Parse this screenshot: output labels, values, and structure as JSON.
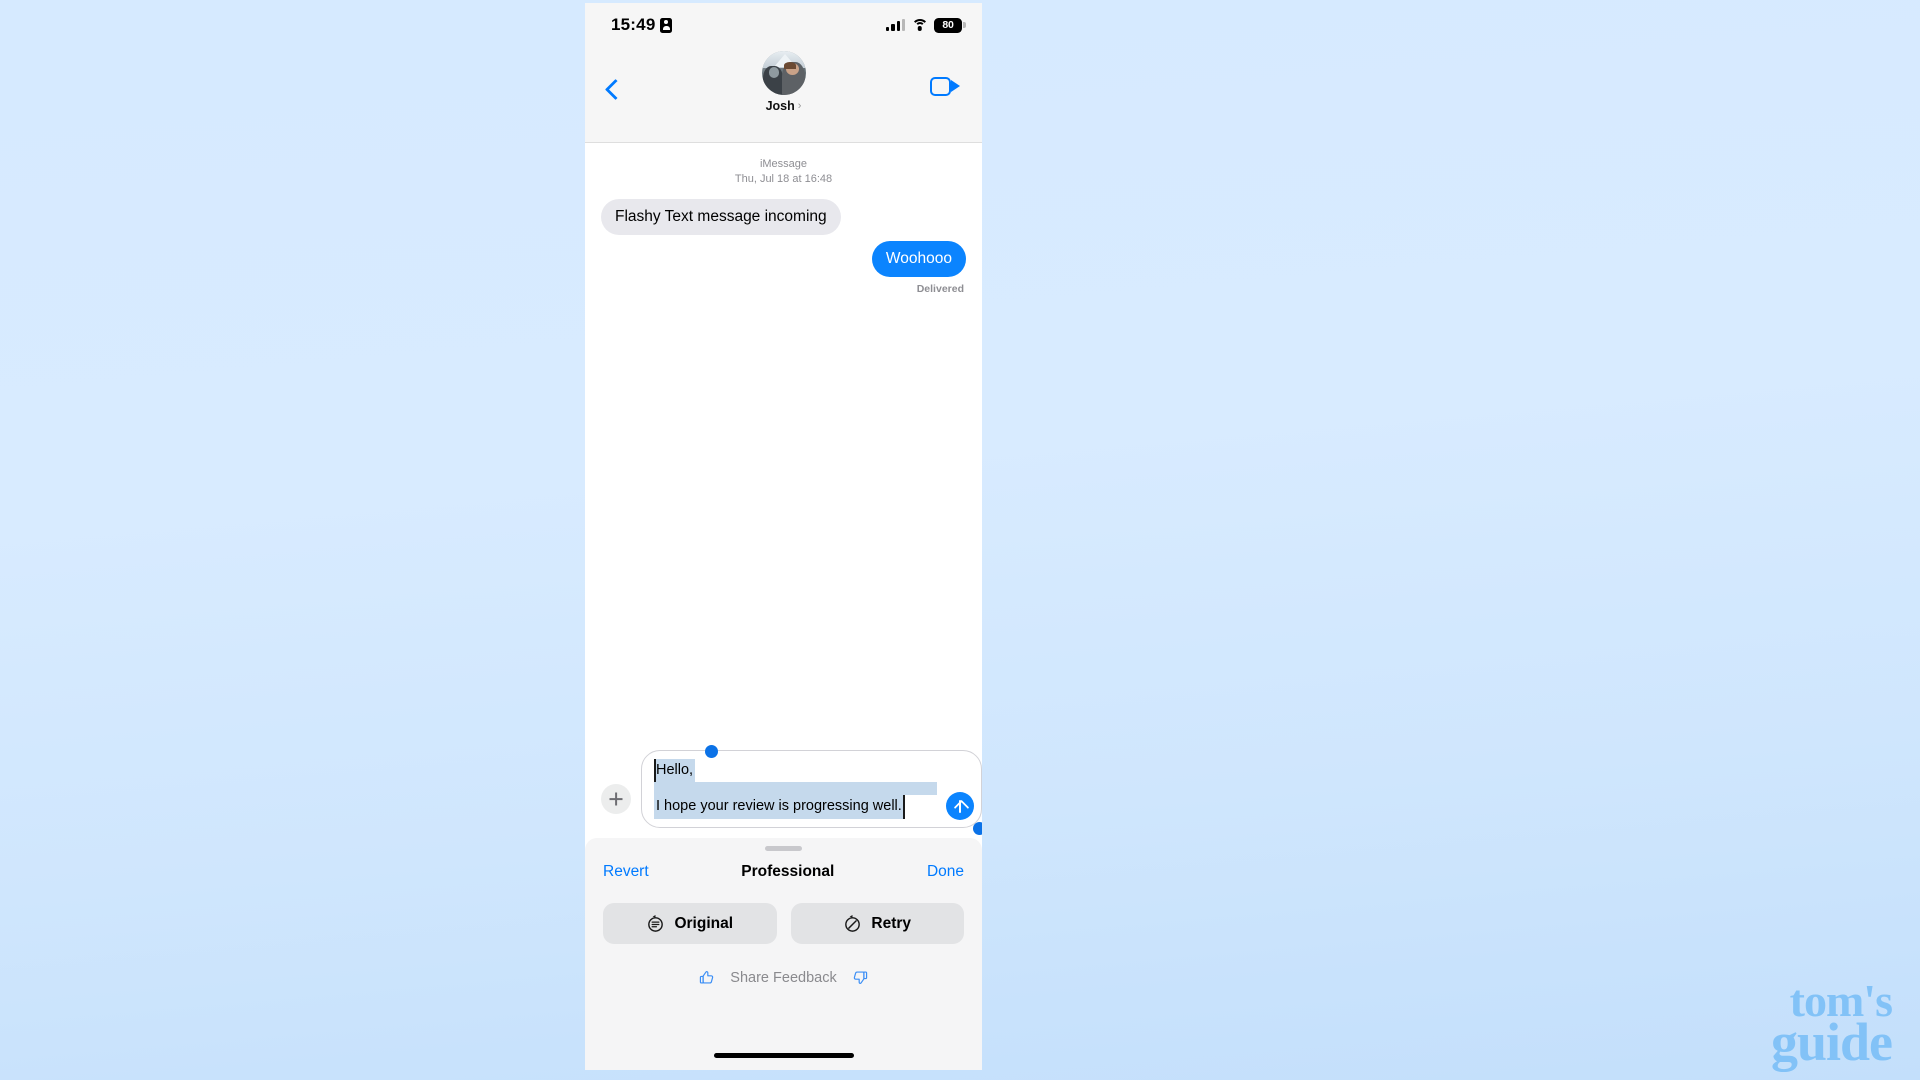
{
  "watermark": {
    "line1": "tom's",
    "line2": "guide"
  },
  "status_bar": {
    "time": "15:49",
    "battery_percent": "80",
    "icons": [
      "id-card-icon",
      "cellular-signal-icon",
      "wifi-icon",
      "battery-icon"
    ]
  },
  "nav": {
    "back_label": "back-chevron",
    "contact_name": "Josh",
    "chevron": "›",
    "video_call_label": "facetime-video"
  },
  "conversation": {
    "service": "iMessage",
    "timestamp": "Thu, Jul 18 at 16:48",
    "messages": [
      {
        "direction": "incoming",
        "text": "Flashy Text message incoming"
      },
      {
        "direction": "outgoing",
        "text": "Woohooo",
        "status": "Delivered"
      }
    ]
  },
  "composer": {
    "add_label": "+",
    "draft_line1": "Hello,",
    "draft_line2": "I hope your review is progressing well.",
    "send_label": "send-arrow-up"
  },
  "sheet": {
    "revert_label": "Revert",
    "title": "Professional",
    "done_label": "Done",
    "actions": [
      {
        "label": "Original",
        "icon": "original-text-icon"
      },
      {
        "label": "Retry",
        "icon": "retry-icon"
      }
    ],
    "feedback_label": "Share Feedback",
    "thumb_up": "thumbs-up-icon",
    "thumb_down": "thumbs-down-icon"
  },
  "colors": {
    "accent_blue": "#007aff",
    "bubble_out": "#0b84fe",
    "bubble_in": "#e8e8ed",
    "selection": "#c5d9ec",
    "sheet_bg": "#f5f5f6",
    "watermark": "#82c2f7"
  }
}
